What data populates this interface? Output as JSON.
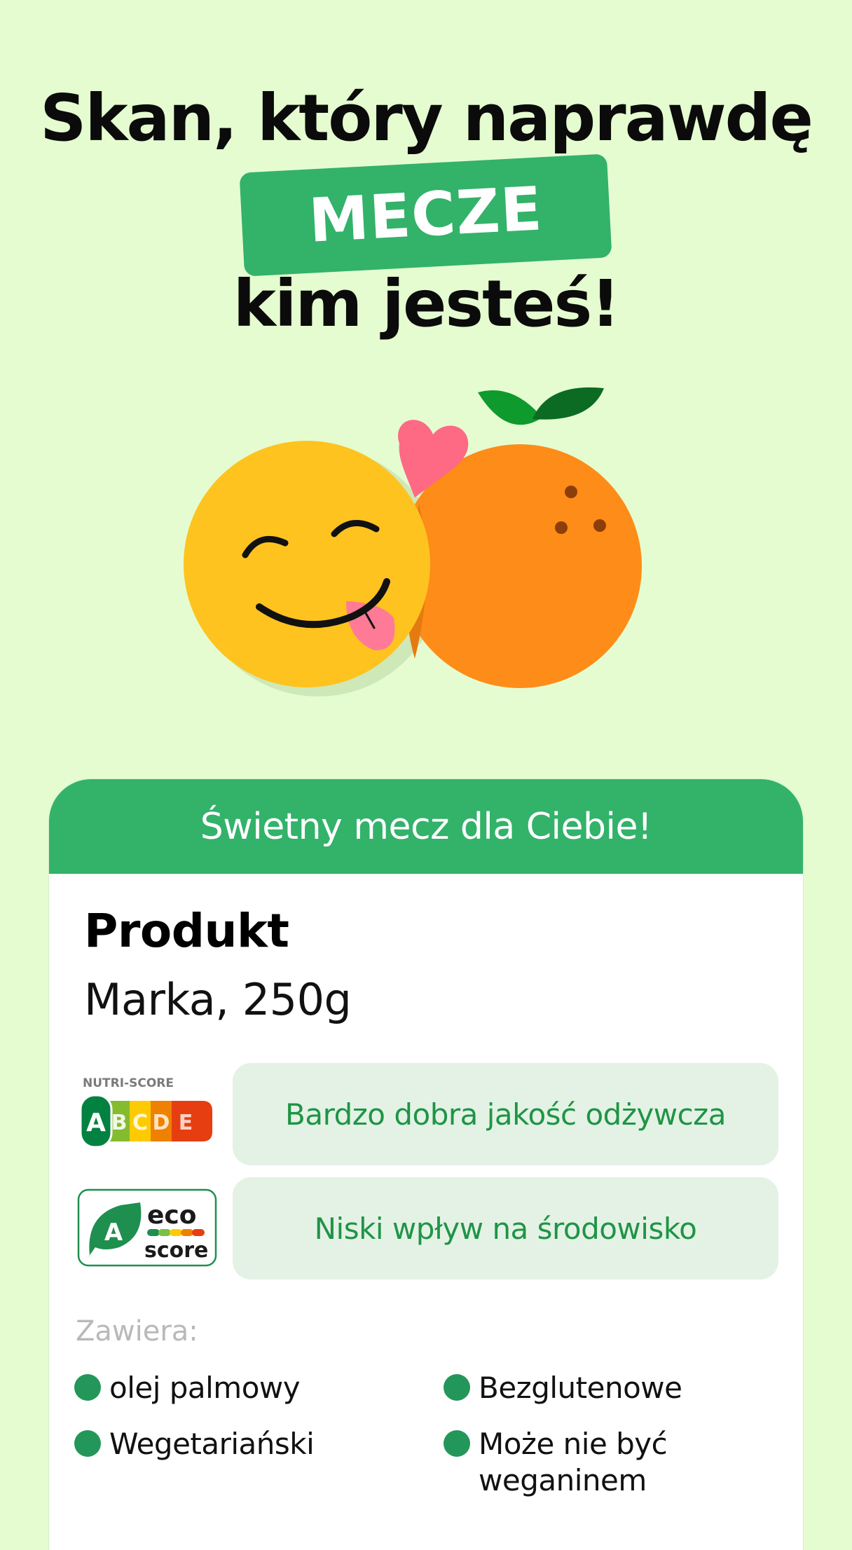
{
  "headline": {
    "line1": "Skan, który naprawdę",
    "highlight": "MECZE",
    "line3": "kim jesteś!"
  },
  "card": {
    "header": "Świetny mecz dla Ciebie!",
    "product_name": "Produkt",
    "product_brand": "Marka, 250g",
    "nutri_score": {
      "label": "NUTRI-SCORE",
      "grade": "A",
      "letters": [
        "A",
        "B",
        "C",
        "D",
        "E"
      ],
      "description": "Bardzo dobra jakość odżywcza"
    },
    "eco_score": {
      "grade": "A",
      "word1": "eco",
      "word2": "score",
      "description": "Niski wpływ na środowisko"
    },
    "contains_title": "Zawiera:",
    "tags": [
      "olej palmowy",
      "Bezglutenowe",
      "Wegetariański",
      "Może nie być weganinem"
    ]
  },
  "colors": {
    "background": "#e5fcd0",
    "accent_green": "#33b26a",
    "pill_bg": "#e4f2e5",
    "pill_text": "#1f9446",
    "tag_dot": "#23975a",
    "smiley": "#fec31f",
    "orange": "#fd8c18",
    "heart": "#fe6983"
  }
}
